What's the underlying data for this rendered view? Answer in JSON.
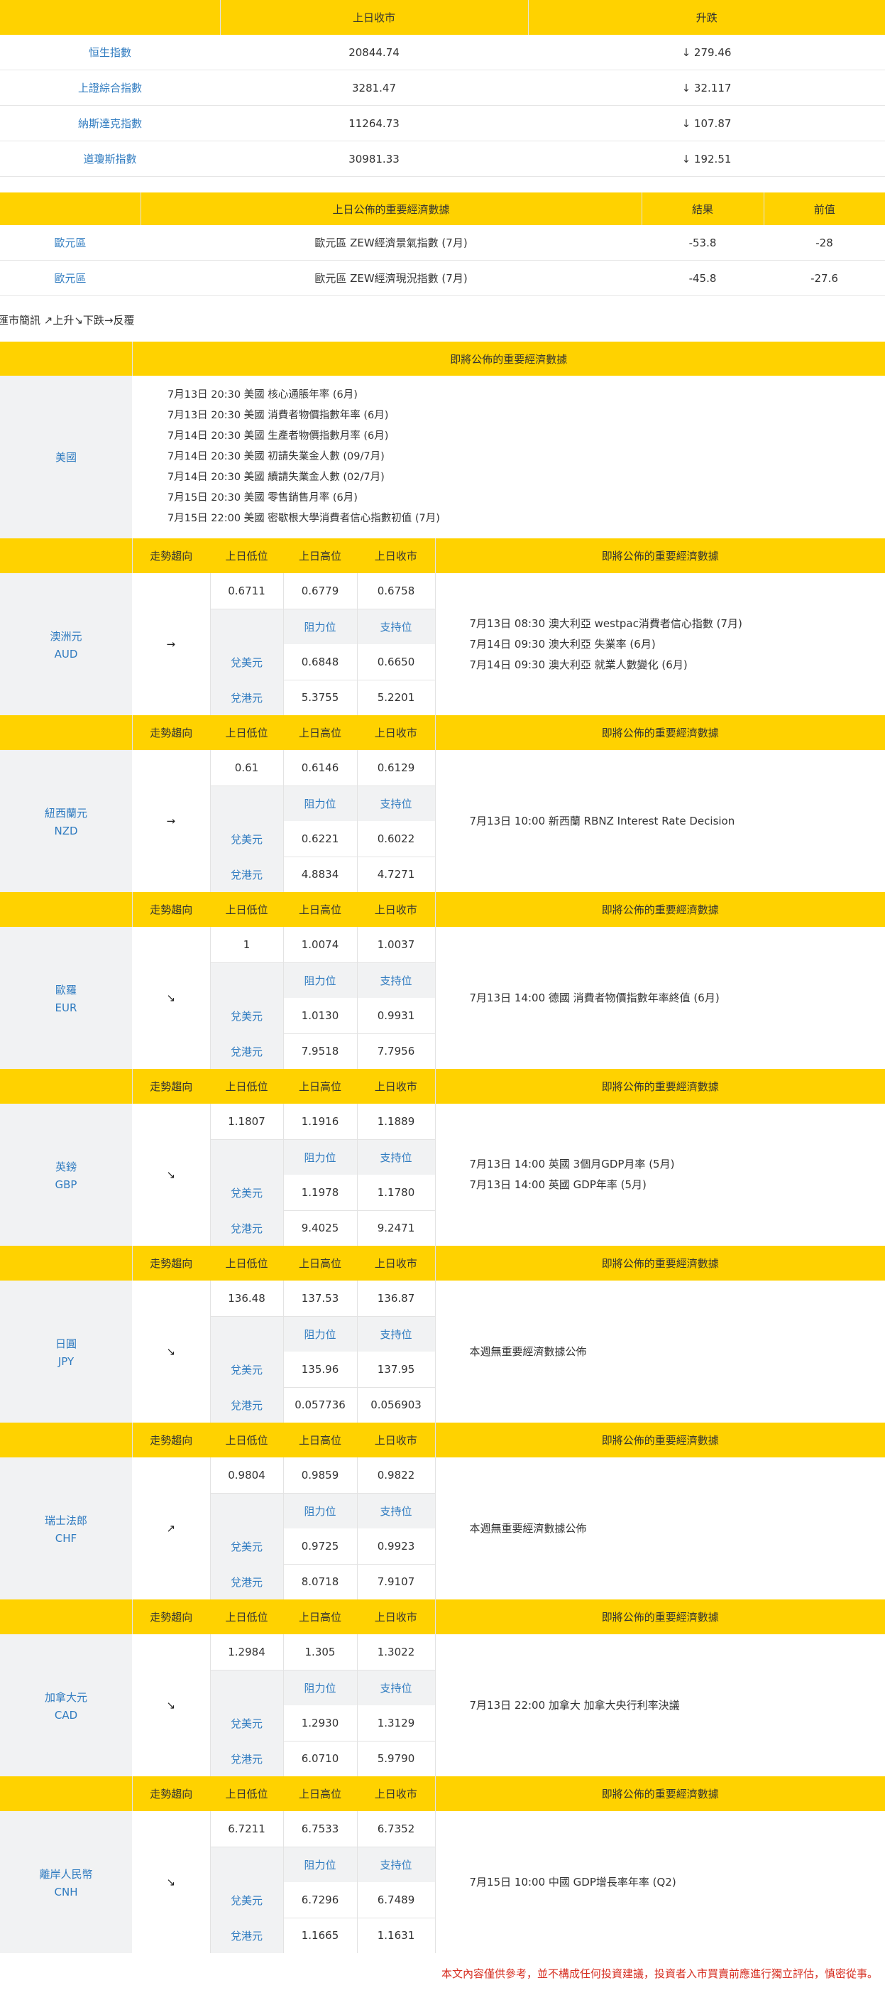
{
  "index_table": {
    "headers": [
      "",
      "上日收市",
      "升跌"
    ],
    "rows": [
      {
        "name": "恒生指數",
        "close": "20844.74",
        "change": "↓ 279.46"
      },
      {
        "name": "上證綜合指數",
        "close": "3281.47",
        "change": "↓ 32.117"
      },
      {
        "name": "納斯達克指數",
        "close": "11264.73",
        "change": "↓ 107.87"
      },
      {
        "name": "道瓊斯指數",
        "close": "30981.33",
        "change": "↓ 192.51"
      }
    ]
  },
  "econ_table": {
    "headers": [
      "",
      "上日公佈的重要經濟數據",
      "結果",
      "前值"
    ],
    "rows": [
      {
        "region": "歐元區",
        "item": "歐元區 ZEW經濟景氣指數 (7月)",
        "result": "-53.8",
        "previous": "-28"
      },
      {
        "region": "歐元區",
        "item": "歐元區 ZEW經濟現況指數 (7月)",
        "result": "-45.8",
        "previous": "-27.6"
      }
    ]
  },
  "legend": "匯市簡訊 ↗上升↘下跌→反覆",
  "usa": {
    "header": "即將公佈的重要經濟數據",
    "name": "美國",
    "events": [
      "7月13日 20:30  美國 核心通脹年率 (6月)",
      "7月13日 20:30  美國 消費者物價指數年率 (6月)",
      "7月14日 20:30  美國 生產者物價指數月率 (6月)",
      "7月14日 20:30  美國 初請失業金人數 (09/7月)",
      "7月14日 20:30  美國 續請失業金人數 (02/7月)",
      "7月15日 20:30  美國 零售銷售月率 (6月)",
      "7月15日 22:00  美國 密歇根大學消費者信心指數初值 (7月)"
    ]
  },
  "currency_headers": {
    "trend": "走勢趨向",
    "low": "上日低位",
    "high": "上日高位",
    "close": "上日收市",
    "upcoming": "即將公佈的重要經濟數據",
    "resistance": "阻力位",
    "support": "支持位",
    "vs_usd": "兌美元",
    "vs_hkd": "兌港元"
  },
  "currencies": [
    {
      "name": "澳洲元",
      "code": "AUD",
      "trend": "→",
      "low": "0.6711",
      "high": "0.6779",
      "close": "0.6758",
      "usd_res": "0.6848",
      "usd_sup": "0.6650",
      "hkd_res": "5.3755",
      "hkd_sup": "5.2201",
      "events": [
        "7月13日 08:30  澳大利亞 westpac消費者信心指數 (7月)",
        "7月14日 09:30  澳大利亞 失業率 (6月)",
        "7月14日 09:30  澳大利亞 就業人數變化 (6月)"
      ]
    },
    {
      "name": "紐西蘭元",
      "code": "NZD",
      "trend": "→",
      "low": "0.61",
      "high": "0.6146",
      "close": "0.6129",
      "usd_res": "0.6221",
      "usd_sup": "0.6022",
      "hkd_res": "4.8834",
      "hkd_sup": "4.7271",
      "events": [
        "7月13日 10:00  新西蘭 RBNZ Interest Rate Decision"
      ]
    },
    {
      "name": "歐羅",
      "code": "EUR",
      "trend": "↘",
      "low": "1",
      "high": "1.0074",
      "close": "1.0037",
      "usd_res": "1.0130",
      "usd_sup": "0.9931",
      "hkd_res": "7.9518",
      "hkd_sup": "7.7956",
      "events": [
        "7月13日 14:00  德國 消費者物價指數年率終值 (6月)"
      ]
    },
    {
      "name": "英鎊",
      "code": "GBP",
      "trend": "↘",
      "low": "1.1807",
      "high": "1.1916",
      "close": "1.1889",
      "usd_res": "1.1978",
      "usd_sup": "1.1780",
      "hkd_res": "9.4025",
      "hkd_sup": "9.2471",
      "events": [
        "7月13日 14:00  英國 3個月GDP月率 (5月)",
        "7月13日 14:00  英國 GDP年率 (5月)"
      ]
    },
    {
      "name": "日圓",
      "code": "JPY",
      "trend": "↘",
      "low": "136.48",
      "high": "137.53",
      "close": "136.87",
      "usd_res": "135.96",
      "usd_sup": "137.95",
      "hkd_res": "0.057736",
      "hkd_sup": "0.056903",
      "events": [
        "本週無重要經濟數據公佈"
      ]
    },
    {
      "name": "瑞士法郎",
      "code": "CHF",
      "trend": "↗",
      "low": "0.9804",
      "high": "0.9859",
      "close": "0.9822",
      "usd_res": "0.9725",
      "usd_sup": "0.9923",
      "hkd_res": "8.0718",
      "hkd_sup": "7.9107",
      "events": [
        "本週無重要經濟數據公佈"
      ]
    },
    {
      "name": "加拿大元",
      "code": "CAD",
      "trend": "↘",
      "low": "1.2984",
      "high": "1.305",
      "close": "1.3022",
      "usd_res": "1.2930",
      "usd_sup": "1.3129",
      "hkd_res": "6.0710",
      "hkd_sup": "5.9790",
      "events": [
        "7月13日 22:00  加拿大 加拿大央行利率決議"
      ]
    },
    {
      "name": "離岸人民幣",
      "code": "CNH",
      "trend": "↘",
      "low": "6.7211",
      "high": "6.7533",
      "close": "6.7352",
      "usd_res": "6.7296",
      "usd_sup": "6.7489",
      "hkd_res": "1.1665",
      "hkd_sup": "1.1631",
      "events": [
        "7月15日 10:00  中國 GDP增長率年率 (Q2)"
      ]
    }
  ],
  "footer": "本文內容僅供參考，並不構成任何投資建議，投資者入市買賣前應進行獨立評估，慎密從事。"
}
